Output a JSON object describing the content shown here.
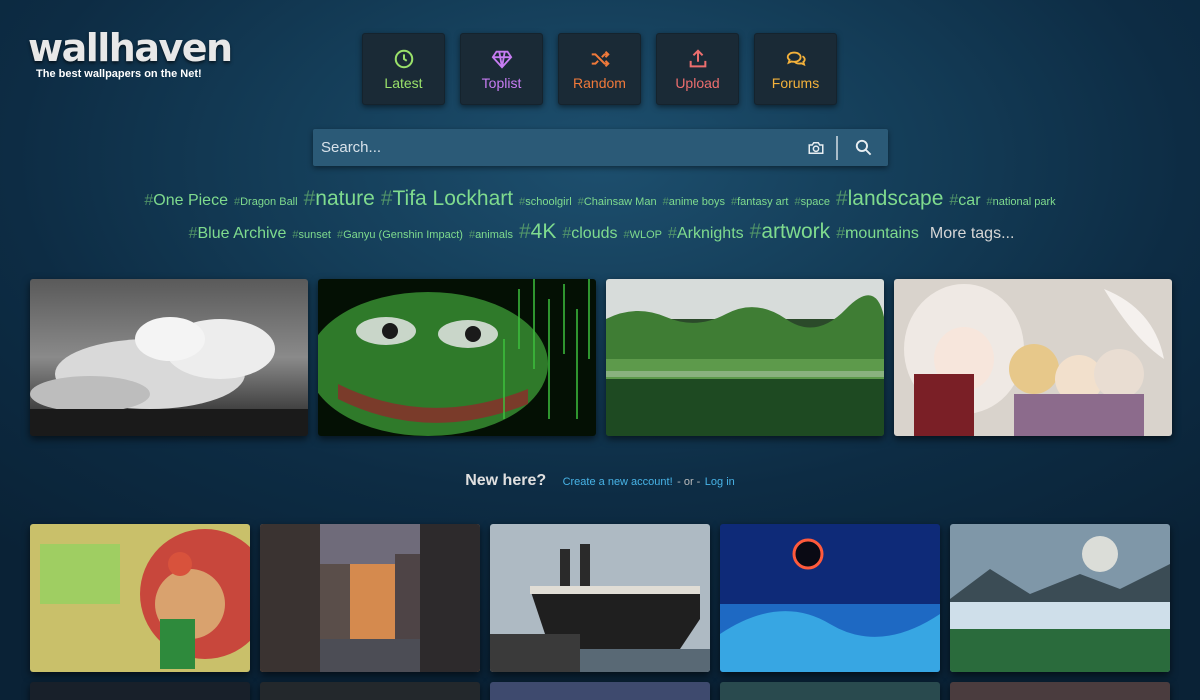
{
  "logo": {
    "text": "wallhaven",
    "tagline": "The best wallpapers on the Net!"
  },
  "nav": [
    {
      "label": "Latest",
      "icon": "clock-icon",
      "color": "#9ae16a"
    },
    {
      "label": "Toplist",
      "icon": "diamond-icon",
      "color": "#c77cf2"
    },
    {
      "label": "Random",
      "icon": "shuffle-icon",
      "color": "#f0793a"
    },
    {
      "label": "Upload",
      "icon": "upload-icon",
      "color": "#ec6e6e"
    },
    {
      "label": "Forums",
      "icon": "chat-bubbles-icon",
      "color": "#f3b13b"
    }
  ],
  "search": {
    "placeholder": "Search..."
  },
  "tags": [
    {
      "text": "One Piece",
      "size": "l"
    },
    {
      "text": "Dragon Ball",
      "size": "s"
    },
    {
      "text": "nature",
      "size": "xl"
    },
    {
      "text": "Tifa Lockhart",
      "size": "xl"
    },
    {
      "text": "schoolgirl",
      "size": "s"
    },
    {
      "text": "Chainsaw Man",
      "size": "s"
    },
    {
      "text": "anime boys",
      "size": "s"
    },
    {
      "text": "fantasy art",
      "size": "s"
    },
    {
      "text": "space",
      "size": "s"
    },
    {
      "text": "landscape",
      "size": "xl"
    },
    {
      "text": "car",
      "size": "l"
    },
    {
      "text": "national park",
      "size": "s"
    },
    {
      "text": "Blue Archive",
      "size": "l"
    },
    {
      "text": "sunset",
      "size": "s"
    },
    {
      "text": "Ganyu (Genshin Impact)",
      "size": "s"
    },
    {
      "text": "animals",
      "size": "s"
    },
    {
      "text": "4K",
      "size": "xl"
    },
    {
      "text": "clouds",
      "size": "l"
    },
    {
      "text": "WLOP",
      "size": "s"
    },
    {
      "text": "Arknights",
      "size": "l"
    },
    {
      "text": "artwork",
      "size": "xl"
    },
    {
      "text": "mountains",
      "size": "l"
    }
  ],
  "more_tags": "More tags...",
  "featured": [
    {
      "name": "wallpaper-black-white-clouds"
    },
    {
      "name": "wallpaper-ascii-green-frog"
    },
    {
      "name": "wallpaper-forest-reflection"
    },
    {
      "name": "wallpaper-anime-fox-girls"
    }
  ],
  "newhere": {
    "question": "New here?",
    "create": "Create a new account!",
    "or": "- or -",
    "login": "Log in"
  },
  "grid": [
    {
      "name": "wallpaper-retro-game-art"
    },
    {
      "name": "wallpaper-city-canal-sunset"
    },
    {
      "name": "wallpaper-ocean-liner"
    },
    {
      "name": "wallpaper-eclipse-aurora"
    },
    {
      "name": "wallpaper-glacier-lake"
    }
  ]
}
